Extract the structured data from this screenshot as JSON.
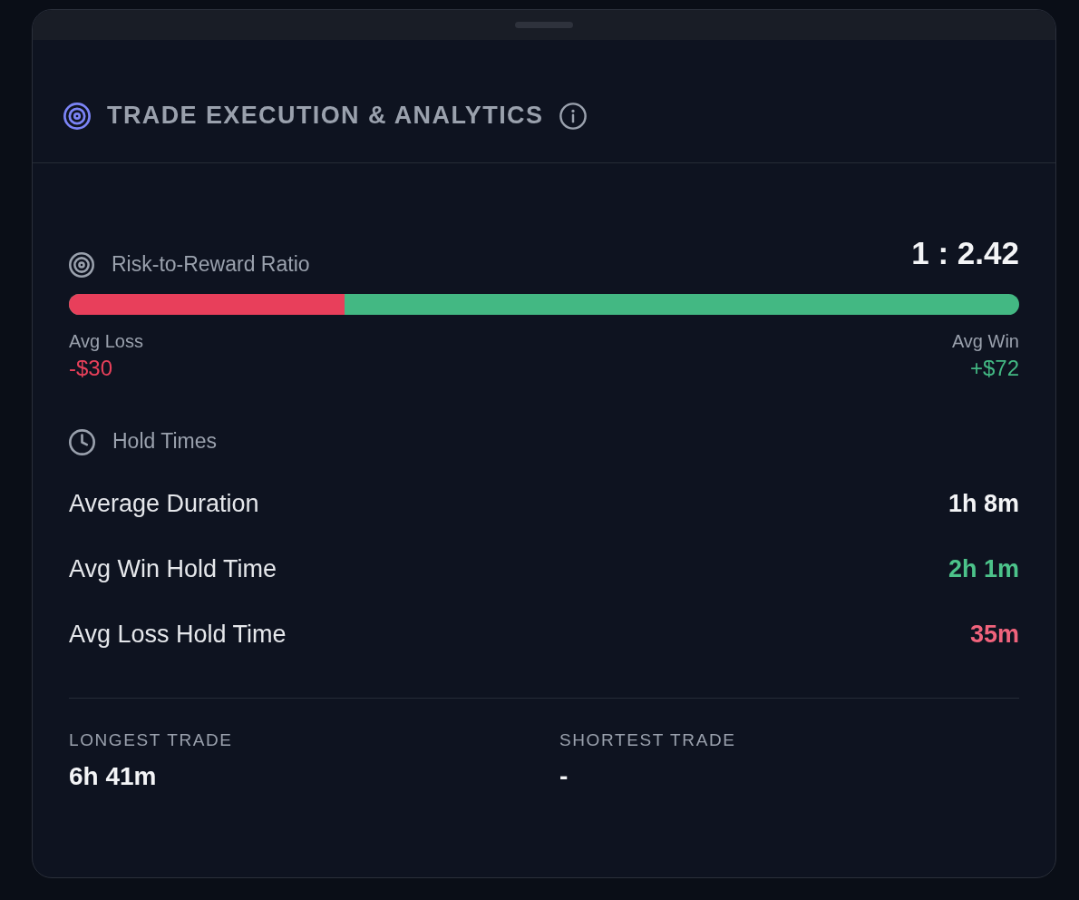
{
  "header": {
    "title": "TRADE EXECUTION & ANALYTICS"
  },
  "risk_reward": {
    "label": "Risk-to-Reward Ratio",
    "ratio": "1 : 2.42",
    "level": 0.29,
    "avg_loss": {
      "label": "Avg Loss",
      "value": "-$30"
    },
    "avg_win": {
      "label": "Avg Win",
      "value": "+$72"
    }
  },
  "hold_times": {
    "label": "Hold Times",
    "rows": [
      {
        "label": "Average Duration",
        "value": "1h 8m",
        "color": "#f3f4f6"
      },
      {
        "label": "Avg Win Hold Time",
        "value": "2h 1m",
        "color": "#4cc38a"
      },
      {
        "label": "Avg Loss Hold Time",
        "value": "35m",
        "color": "#f0637c"
      }
    ]
  },
  "extremes": [
    {
      "label": "LONGEST TRADE",
      "value": "6h 41m"
    },
    {
      "label": "SHORTEST TRADE",
      "value": "-"
    }
  ]
}
